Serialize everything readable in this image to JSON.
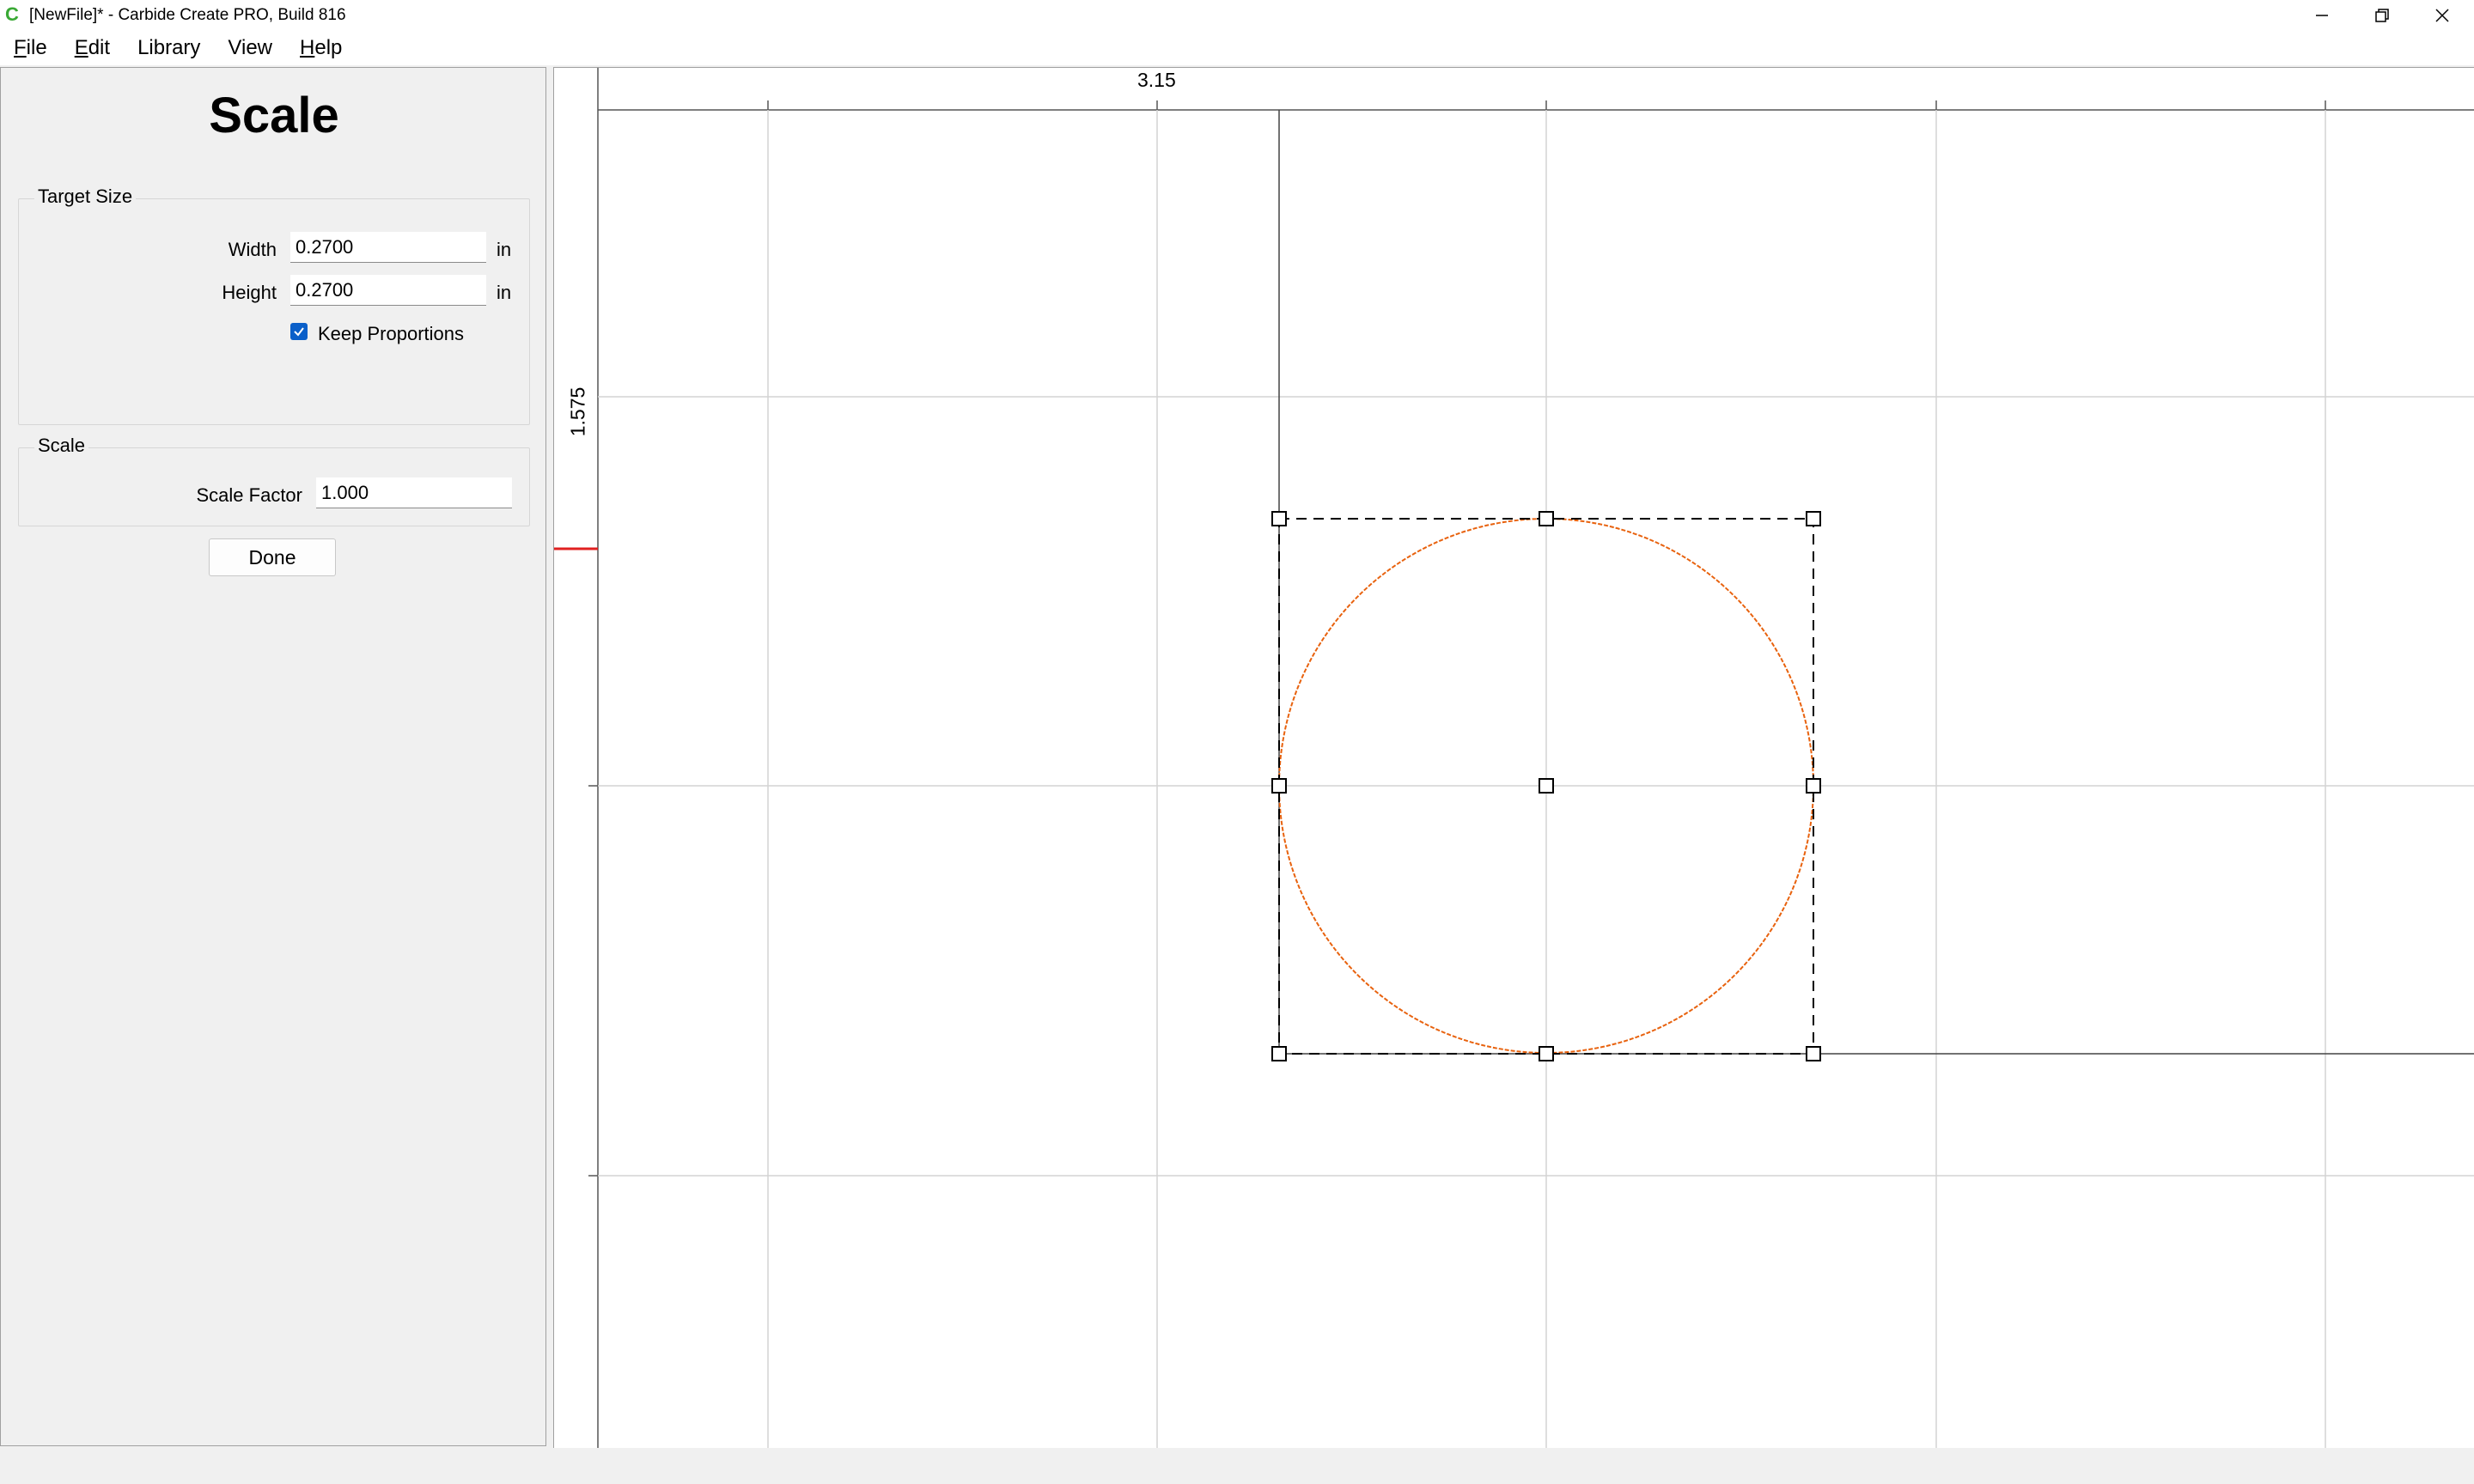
{
  "window": {
    "title": "[NewFile]* - Carbide Create PRO, Build 816",
    "app_icon": "C",
    "controls": [
      "minimize-icon",
      "restore-icon",
      "close-icon"
    ]
  },
  "menu": {
    "items": [
      "File",
      "Edit",
      "Library",
      "View",
      "Help"
    ]
  },
  "panel": {
    "title": "Scale",
    "target_size": {
      "group_label": "Target Size",
      "width_label": "Width",
      "width_value": "0.2700",
      "width_unit": "in",
      "height_label": "Height",
      "height_value": "0.2700",
      "height_unit": "in",
      "keep_proportions_label": "Keep Proportions",
      "keep_proportions_checked": true
    },
    "scale": {
      "group_label": "Scale",
      "factor_label": "Scale Factor",
      "factor_value": "1.000"
    },
    "done_label": "Done"
  },
  "canvas": {
    "ruler_x_label": "3.15",
    "ruler_y_label": "1.575",
    "shape_color": "#e8620e",
    "selection_color": "#000000",
    "ruler_marker_color": "#e02020"
  }
}
